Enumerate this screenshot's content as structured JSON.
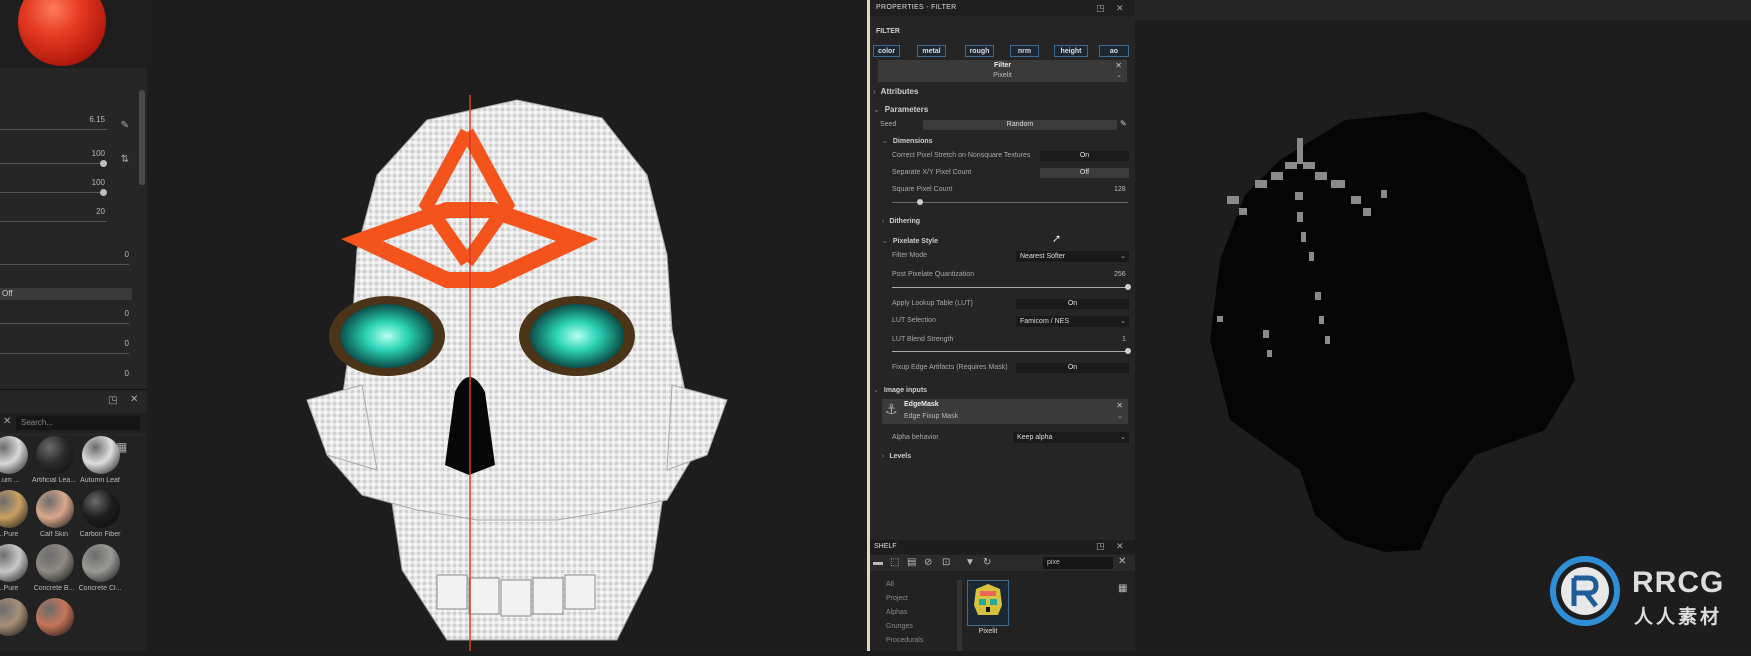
{
  "left_panel": {
    "sliders": [
      {
        "value": "6.15",
        "fill": 0.62
      },
      {
        "value": "100",
        "fill": 1.0
      },
      {
        "value": "100",
        "fill": 1.0
      },
      {
        "value": "20",
        "fill": 0.2
      },
      {
        "value": "0",
        "fill": 0.0
      }
    ],
    "off_label": "Off",
    "lower_values": [
      "0",
      "0",
      "0"
    ],
    "search_placeholder": "Search...",
    "materials": [
      {
        "label": "...um ...",
        "color": "#d8d8d8"
      },
      {
        "label": "Artificial Lea...",
        "color": "#2a2a2a"
      },
      {
        "label": "Autumn Leaf",
        "color": "#dedede"
      },
      {
        "label": "...Pure",
        "color": "#c9a063"
      },
      {
        "label": "Calf Skin",
        "color": "#d9a88c"
      },
      {
        "label": "Carbon Fiber",
        "color": "#1e1e1e"
      },
      {
        "label": "...Pure",
        "color": "#c8c8c8"
      },
      {
        "label": "Concrete B...",
        "color": "#8e8a82"
      },
      {
        "label": "Concrete Cl...",
        "color": "#9a9a96"
      },
      {
        "label": "",
        "color": "#a89078"
      },
      {
        "label": "",
        "color": "#c6765a"
      }
    ]
  },
  "properties": {
    "window_title": "PROPERTIES - FILTER",
    "filter_section": "FILTER",
    "channels": [
      "color",
      "metal",
      "rough",
      "nrm",
      "height",
      "ao"
    ],
    "filter_name": "Filter",
    "filter_sub": "Pixelit",
    "attributes_label": "Attributes",
    "parameters_label": "Parameters",
    "seed_label": "Seed",
    "seed_value": "Random",
    "dimensions_label": "Dimensions",
    "correct_pixel_label": "Correct Pixel Stretch on Nonsquare Textures",
    "correct_pixel_value": "On",
    "separate_xy_label": "Separate X/Y Pixel Count",
    "separate_xy_value": "Off",
    "square_pixel_label": "Square Pixel Count",
    "square_pixel_value": "128",
    "square_pixel_fraction": 0.12,
    "dithering_label": "Dithering",
    "pixelate_style_label": "Pixelate Style",
    "filter_mode_label": "Filter Mode",
    "filter_mode_value": "Nearest Softer",
    "post_quant_label": "Post Pixelate Quantization",
    "post_quant_value": "256",
    "post_quant_fraction": 1.0,
    "apply_lut_label": "Apply Lookup Table (LUT)",
    "apply_lut_value": "On",
    "lut_selection_label": "LUT Selection",
    "lut_selection_value": "Famicom / NES",
    "lut_blend_label": "LUT Blend Strength",
    "lut_blend_value": "1",
    "lut_blend_fraction": 1.0,
    "fixup_label": "Fixup Edge Artifacts (Requires Mask)",
    "fixup_value": "On",
    "image_inputs_label": "Image inputs",
    "edge_mask_label": "EdgeMask",
    "edge_mask_sub": "Edge Fixup Mask",
    "alpha_behavior_label": "Alpha behavior",
    "alpha_behavior_value": "Keep alpha",
    "levels_label": "Levels"
  },
  "shelf": {
    "title": "SHELF",
    "search_value": "pixe",
    "categories": [
      "All",
      "Project",
      "Alphas",
      "Grunges",
      "Procedurals"
    ],
    "thumb_label": "Pixelit"
  },
  "watermark": {
    "text": "RRCG",
    "cn": "人人素材"
  },
  "colors": {
    "accent_blue": "#3f6c8f",
    "skull_orange": "#f4541c",
    "eye_teal": "#2ad3b4"
  }
}
